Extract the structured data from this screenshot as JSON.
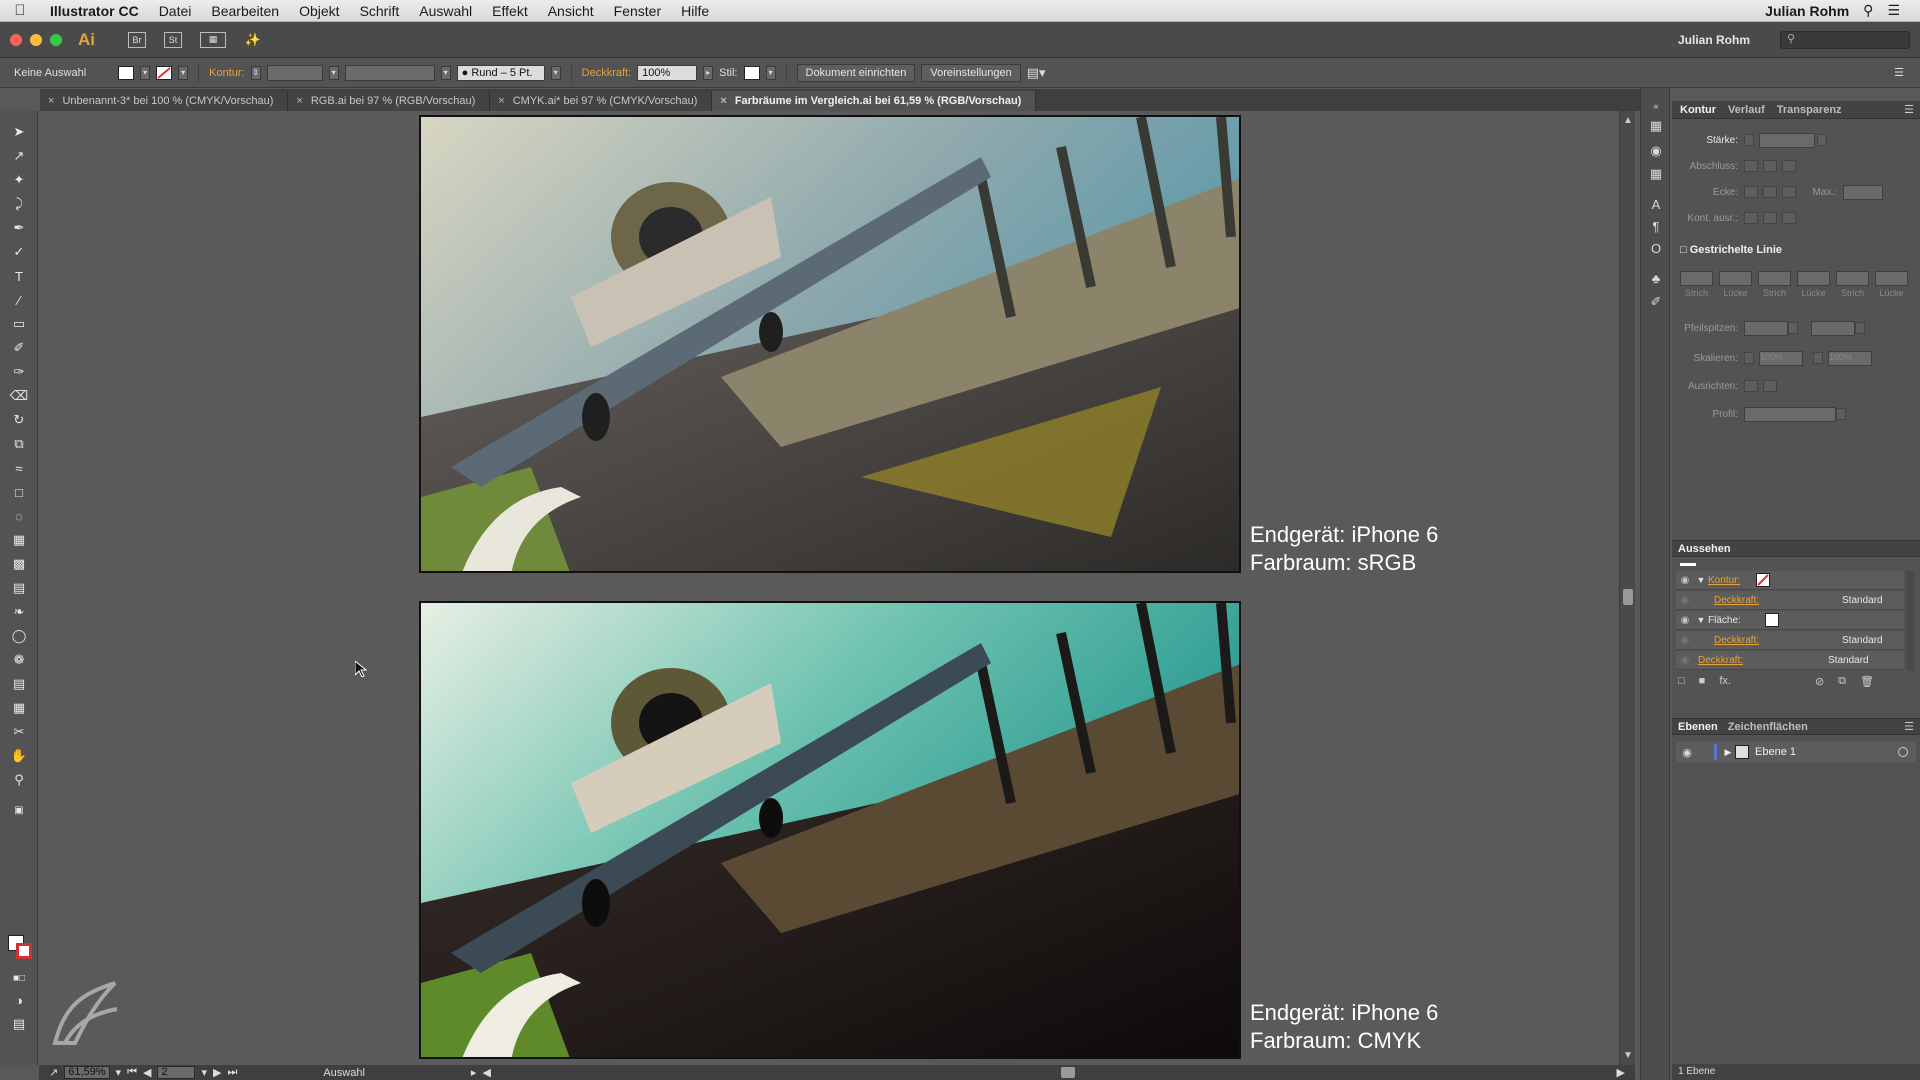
{
  "menubar": {
    "app_name": "Illustrator CC",
    "items": [
      "Datei",
      "Bearbeiten",
      "Objekt",
      "Schrift",
      "Auswahl",
      "Effekt",
      "Ansicht",
      "Fenster",
      "Hilfe"
    ],
    "user": "Julian Rohm"
  },
  "appbar": {
    "logo": "Ai",
    "bridge": "Br",
    "stock": "St",
    "workspace": "Julian Rohm"
  },
  "controlbar": {
    "selection": "Keine Auswahl",
    "kontur_label": "Kontur:",
    "brush": "Rund – 5 Pt.",
    "deckkraft_label": "Deckkraft:",
    "deckkraft_value": "100%",
    "stil_label": "Stil:",
    "setup_button": "Dokument einrichten",
    "prefs_button": "Voreinstellungen"
  },
  "tabs": [
    {
      "label": "Unbenannt-3* bei 100 % (CMYK/Vorschau)",
      "active": false
    },
    {
      "label": "RGB.ai bei 97 % (RGB/Vorschau)",
      "active": false
    },
    {
      "label": "CMYK.ai* bei 97 % (CMYK/Vorschau)",
      "active": false
    },
    {
      "label": "Farbräume im Vergleich.ai bei 61,59 % (RGB/Vorschau)",
      "active": true
    }
  ],
  "canvas": {
    "caption1_line1": "Endgerät: iPhone 6",
    "caption1_line2": "Farbraum: sRGB",
    "caption2_line1": "Endgerät: iPhone 6",
    "caption2_line2": "Farbraum: CMYK"
  },
  "statusbar": {
    "zoom": "61,59%",
    "artboard": "2",
    "tool": "Auswahl"
  },
  "stroke_panel": {
    "tabs": [
      "Kontur",
      "Verlauf",
      "Transparenz"
    ],
    "staerke": "Stärke:",
    "abschluss": "Abschluss:",
    "ecke": "Ecke:",
    "max": "Max.:",
    "kont_ausr": "Kont. ausr.:",
    "dashed": "Gestrichelte Linie",
    "dash_caps": [
      "Strich",
      "Lücke",
      "Strich",
      "Lücke",
      "Strich",
      "Lücke"
    ],
    "pfeilspitzen": "Pfeilspitzen:",
    "skalieren": "Skalieren:",
    "skal_val1": "100%",
    "skal_val2": "100%",
    "ausrichten": "Ausrichten:",
    "profil": "Profil:"
  },
  "appearance_panel": {
    "title": "Aussehen",
    "rows": [
      {
        "label": "Kontur:",
        "value": "",
        "kind": "stroke"
      },
      {
        "label": "Deckkraft:",
        "value": "Standard",
        "kind": "sub"
      },
      {
        "label": "Fläche:",
        "value": "",
        "kind": "fill"
      },
      {
        "label": "Deckkraft:",
        "value": "Standard",
        "kind": "sub"
      },
      {
        "label": "Deckkraft:",
        "value": "Standard",
        "kind": "root"
      }
    ],
    "fx": "fx."
  },
  "layers_panel": {
    "tabs": [
      "Ebenen",
      "Zeichenflächen"
    ],
    "layer_name": "Ebene 1",
    "footer": "1 Ebene"
  },
  "colors": {
    "accent": "#e8a23b",
    "panel_bg": "#535353",
    "canvas_bg": "#5a5a5a"
  }
}
